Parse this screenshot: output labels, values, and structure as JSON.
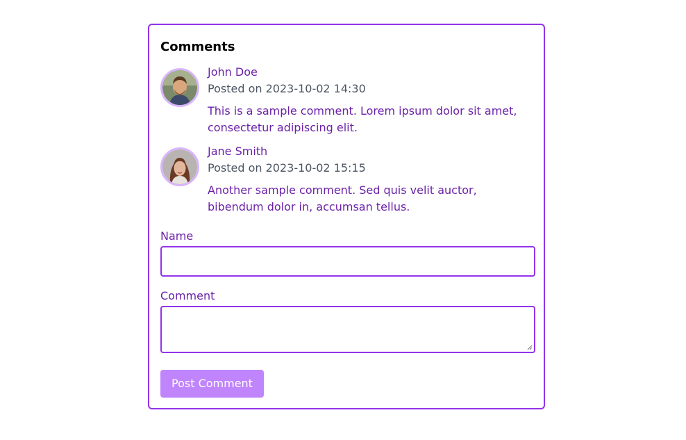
{
  "section": {
    "title": "Comments"
  },
  "comments": [
    {
      "author": "John Doe",
      "posted_prefix": "Posted on",
      "timestamp": "2023-10-02 14:30",
      "text": "This is a sample comment. Lorem ipsum dolor sit amet, consectetur adipiscing elit.",
      "avatar_icon": "avatar-photo-man"
    },
    {
      "author": "Jane Smith",
      "posted_prefix": "Posted on",
      "timestamp": "2023-10-02 15:15",
      "text": "Another sample comment. Sed quis velit auctor, bibendum dolor in, accumsan tellus.",
      "avatar_icon": "avatar-photo-woman"
    }
  ],
  "form": {
    "name_label": "Name",
    "name_value": "",
    "comment_label": "Comment",
    "comment_value": "",
    "submit_label": "Post Comment"
  },
  "colors": {
    "accent": "#9333ea",
    "text_purple": "#6b21a8",
    "meta_gray": "#4b5563",
    "button_bg": "#c084fc",
    "avatar_ring": "#d8b4fe"
  }
}
